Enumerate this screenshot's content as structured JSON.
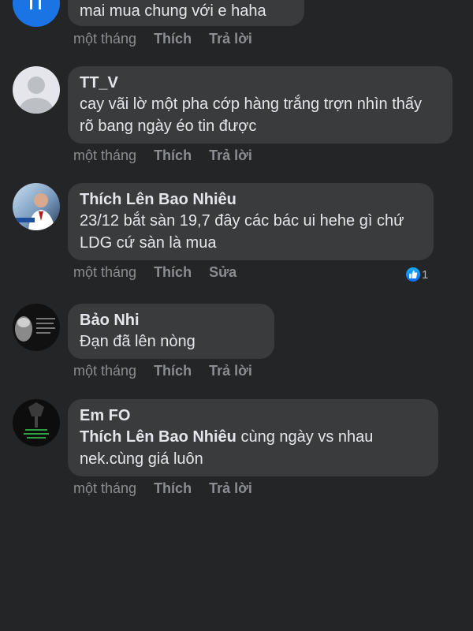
{
  "comments": [
    {
      "author": "",
      "text": "mai mua chung với e haha",
      "time": "một tháng",
      "like_label": "Thích",
      "reply_label": "Trả lời"
    },
    {
      "author": "TT_V",
      "text": "cay vãi lờ một pha cớp hàng trắng trợn nhìn thấy rõ bang ngày éo tin được",
      "time": "một tháng",
      "like_label": "Thích",
      "reply_label": "Trả lời"
    },
    {
      "author": "Thích Lên Bao Nhiêu",
      "text": "23/12 bắt sàn 19,7 đây các bác ui hehe gì chứ LDG cứ sàn là mua",
      "time": "một tháng",
      "like_label": "Thích",
      "reply_label": "Sửa",
      "reaction_count": "1"
    },
    {
      "author": "Bảo Nhi",
      "text": "Đạn đã lên nòng",
      "time": "một tháng",
      "like_label": "Thích",
      "reply_label": "Trả lời"
    },
    {
      "author": "Em FO",
      "mention": "Thích Lên Bao Nhiêu",
      "text": " cùng ngày vs nhau nek.cùng giá luôn",
      "time": "một tháng",
      "like_label": "Thích",
      "reply_label": "Trả lời"
    }
  ],
  "colors": {
    "background": "#242526",
    "bubble": "#3a3b3c",
    "meta": "#8a8d91",
    "like_blue": "#1877f2"
  }
}
